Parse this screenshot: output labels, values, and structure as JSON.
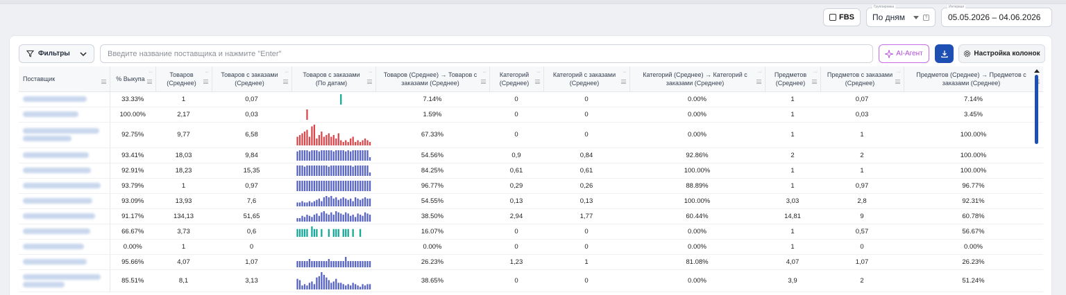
{
  "header": {
    "fbs_label": "FBS",
    "grouping_label": "Группировка",
    "grouping_value": "По дням",
    "interval_label": "Интервал",
    "interval_value": "05.05.2026 – 04.06.2026"
  },
  "toolbar": {
    "filters_label": "Фильтры",
    "search_placeholder": "Введите название поставщика и нажмите \"Enter\"",
    "ai_label": "AI-Агент",
    "columns_label": "Настройка колонок"
  },
  "colors": {
    "accent": "#1e4fb3",
    "ai": "#b04ad8",
    "spark_red": "#d9474b",
    "spark_blue": "#5663c3",
    "spark_teal": "#17a89a"
  },
  "table": {
    "headers": [
      "Поставщик",
      "% Выкупа",
      "Товаров (Среднее)",
      "Товаров с заказами (Среднее)",
      "Товаров с заказами (По датам)",
      "Товаров (Среднее) → Товаров с заказами (Среднее)",
      "Категорий (Среднее)",
      "Категорий с заказами (Среднее)",
      "Категорий (Среднее) → Категорий с заказами (Среднее)",
      "Предметов (Среднее)",
      "Предметов с заказами (Среднее)",
      "Предметов (Среднее) → Предметов с заказами (Среднее)"
    ],
    "rows": [
      {
        "buyout": "33.33%",
        "goods": "1",
        "goods_orders": "0,07",
        "spark": {
          "color": "teal",
          "style": "bars",
          "values": [
            0,
            0,
            0,
            0,
            0,
            0,
            0,
            0,
            0,
            0,
            0,
            0,
            0,
            0,
            0,
            0,
            0,
            0,
            1,
            0,
            0,
            0,
            0,
            0,
            0,
            0,
            0,
            0,
            0,
            0,
            0
          ]
        },
        "goods_conv": "7.14%",
        "cats": "0",
        "cats_orders": "0",
        "cats_conv": "0.00%",
        "items": "1",
        "items_orders": "0,07",
        "items_conv": "7.14%"
      },
      {
        "buyout": "100.00%",
        "goods": "2,17",
        "goods_orders": "0,03",
        "spark": {
          "color": "red",
          "style": "bars",
          "values": [
            0,
            0,
            0,
            0,
            1,
            0,
            0,
            0,
            0,
            0,
            0,
            0,
            0,
            0,
            0,
            0,
            0,
            0,
            0,
            0,
            0,
            0,
            0,
            0,
            0,
            0,
            0,
            0,
            0,
            0,
            0
          ]
        },
        "goods_conv": "1.59%",
        "cats": "0",
        "cats_orders": "0",
        "cats_conv": "0.00%",
        "items": "1",
        "items_orders": "0,03",
        "items_conv": "3.45%"
      },
      {
        "buyout": "92.75%",
        "goods": "9,77",
        "goods_orders": "6,58",
        "spark": {
          "color": "red",
          "style": "bars",
          "values": [
            5,
            6,
            7,
            8,
            9,
            5,
            11,
            12,
            4,
            6,
            8,
            5,
            6,
            7,
            5,
            6,
            4,
            7,
            3,
            2,
            3,
            2,
            4,
            5,
            2,
            3,
            2,
            3,
            4,
            3,
            2
          ]
        },
        "goods_conv": "67.33%",
        "cats": "0",
        "cats_orders": "0",
        "cats_conv": "0.00%",
        "items": "1",
        "items_orders": "1",
        "items_conv": "100.00%"
      },
      {
        "buyout": "93.41%",
        "goods": "18,03",
        "goods_orders": "9,84",
        "spark": {
          "color": "blue",
          "style": "bars",
          "values": [
            8,
            9,
            9,
            9,
            9,
            8,
            9,
            9,
            9,
            8,
            9,
            9,
            9,
            9,
            9,
            8,
            9,
            9,
            9,
            9,
            8,
            9,
            8,
            9,
            9,
            9,
            9,
            9,
            9,
            9,
            3
          ]
        },
        "goods_conv": "54.56%",
        "cats": "0,9",
        "cats_orders": "0,84",
        "cats_conv": "92.86%",
        "items": "2",
        "items_orders": "2",
        "items_conv": "100.00%"
      },
      {
        "buyout": "92.91%",
        "goods": "18,23",
        "goods_orders": "15,35",
        "spark": {
          "color": "blue",
          "style": "bars",
          "values": [
            9,
            9,
            9,
            8,
            9,
            9,
            9,
            9,
            9,
            9,
            9,
            9,
            9,
            8,
            9,
            9,
            9,
            9,
            9,
            9,
            9,
            9,
            9,
            8,
            9,
            9,
            9,
            9,
            9,
            9,
            3
          ]
        },
        "goods_conv": "84.25%",
        "cats": "0,61",
        "cats_orders": "0,61",
        "cats_conv": "100.00%",
        "items": "1",
        "items_orders": "1",
        "items_conv": "100.00%"
      },
      {
        "buyout": "93.79%",
        "goods": "1",
        "goods_orders": "0,97",
        "spark": {
          "color": "blue",
          "style": "bars",
          "values": [
            4,
            4,
            4,
            4,
            4,
            4,
            4,
            4,
            4,
            4,
            4,
            4,
            4,
            4,
            4,
            4,
            4,
            4,
            4,
            4,
            4,
            4,
            4,
            4,
            4,
            4,
            4,
            4,
            4,
            4,
            4
          ]
        },
        "goods_conv": "96.77%",
        "cats": "0,29",
        "cats_orders": "0,26",
        "cats_conv": "88.89%",
        "items": "1",
        "items_orders": "0,97",
        "items_conv": "96.77%"
      },
      {
        "buyout": "93.09%",
        "goods": "13,93",
        "goods_orders": "7,6",
        "spark": {
          "color": "blue",
          "style": "bars",
          "values": [
            3,
            3,
            4,
            3,
            3,
            4,
            3,
            4,
            5,
            6,
            4,
            7,
            8,
            7,
            8,
            6,
            7,
            5,
            6,
            7,
            6,
            5,
            6,
            4,
            7,
            6,
            5,
            6,
            7,
            6,
            6
          ]
        },
        "goods_conv": "54.55%",
        "cats": "0,13",
        "cats_orders": "0,13",
        "cats_conv": "100.00%",
        "items": "3,03",
        "items_orders": "2,8",
        "items_conv": "92.31%"
      },
      {
        "buyout": "91.17%",
        "goods": "134,13",
        "goods_orders": "51,65",
        "spark": {
          "color": "blue",
          "style": "bars",
          "values": [
            3,
            3,
            5,
            4,
            6,
            5,
            4,
            6,
            7,
            5,
            8,
            9,
            7,
            6,
            8,
            6,
            9,
            8,
            7,
            6,
            8,
            7,
            5,
            6,
            4,
            7,
            6,
            5,
            8,
            7,
            6
          ]
        },
        "goods_conv": "38.50%",
        "cats": "2,94",
        "cats_orders": "1,77",
        "cats_conv": "60.44%",
        "items": "14,81",
        "items_orders": "9",
        "items_conv": "60.78%"
      },
      {
        "buyout": "66.67%",
        "goods": "3,73",
        "goods_orders": "0,6",
        "spark": {
          "color": "teal",
          "style": "bars",
          "values": [
            3,
            3,
            3,
            3,
            3,
            0,
            4,
            3,
            3,
            0,
            3,
            0,
            0,
            3,
            0,
            3,
            3,
            3,
            0,
            3,
            3,
            3,
            0,
            3,
            0,
            0,
            3,
            0,
            0,
            0,
            0
          ]
        },
        "goods_conv": "16.07%",
        "cats": "0",
        "cats_orders": "0",
        "cats_conv": "0.00%",
        "items": "1",
        "items_orders": "0,57",
        "items_conv": "56.67%"
      },
      {
        "buyout": "0.00%",
        "goods": "1",
        "goods_orders": "0",
        "spark": {
          "color": "blue",
          "style": "none",
          "values": []
        },
        "goods_conv": "0.00%",
        "cats": "0",
        "cats_orders": "0",
        "cats_conv": "0.00%",
        "items": "1",
        "items_orders": "0",
        "items_conv": "0.00%"
      },
      {
        "buyout": "95.66%",
        "goods": "4,07",
        "goods_orders": "1,07",
        "spark": {
          "color": "blue",
          "style": "bars",
          "values": [
            3,
            3,
            3,
            3,
            3,
            4,
            3,
            3,
            3,
            3,
            3,
            3,
            3,
            4,
            3,
            3,
            3,
            3,
            3,
            3,
            5,
            3,
            3,
            3,
            3,
            3,
            3,
            3,
            3,
            3,
            3
          ]
        },
        "goods_conv": "26.23%",
        "cats": "1,23",
        "cats_orders": "1",
        "cats_conv": "81.08%",
        "items": "4,07",
        "items_orders": "1,07",
        "items_conv": "26.23%"
      },
      {
        "buyout": "85.51%",
        "goods": "8,1",
        "goods_orders": "3,13",
        "spark": {
          "color": "blue",
          "style": "bars",
          "values": [
            8,
            7,
            3,
            4,
            3,
            5,
            6,
            4,
            9,
            10,
            13,
            11,
            9,
            7,
            5,
            6,
            8,
            5,
            5,
            4,
            3,
            4,
            3,
            5,
            4,
            3,
            2,
            4,
            3,
            4,
            4
          ]
        },
        "goods_conv": "38.65%",
        "cats": "0",
        "cats_orders": "0",
        "cats_conv": "0.00%",
        "items": "3,9",
        "items_orders": "2",
        "items_conv": "51.24%"
      }
    ]
  }
}
